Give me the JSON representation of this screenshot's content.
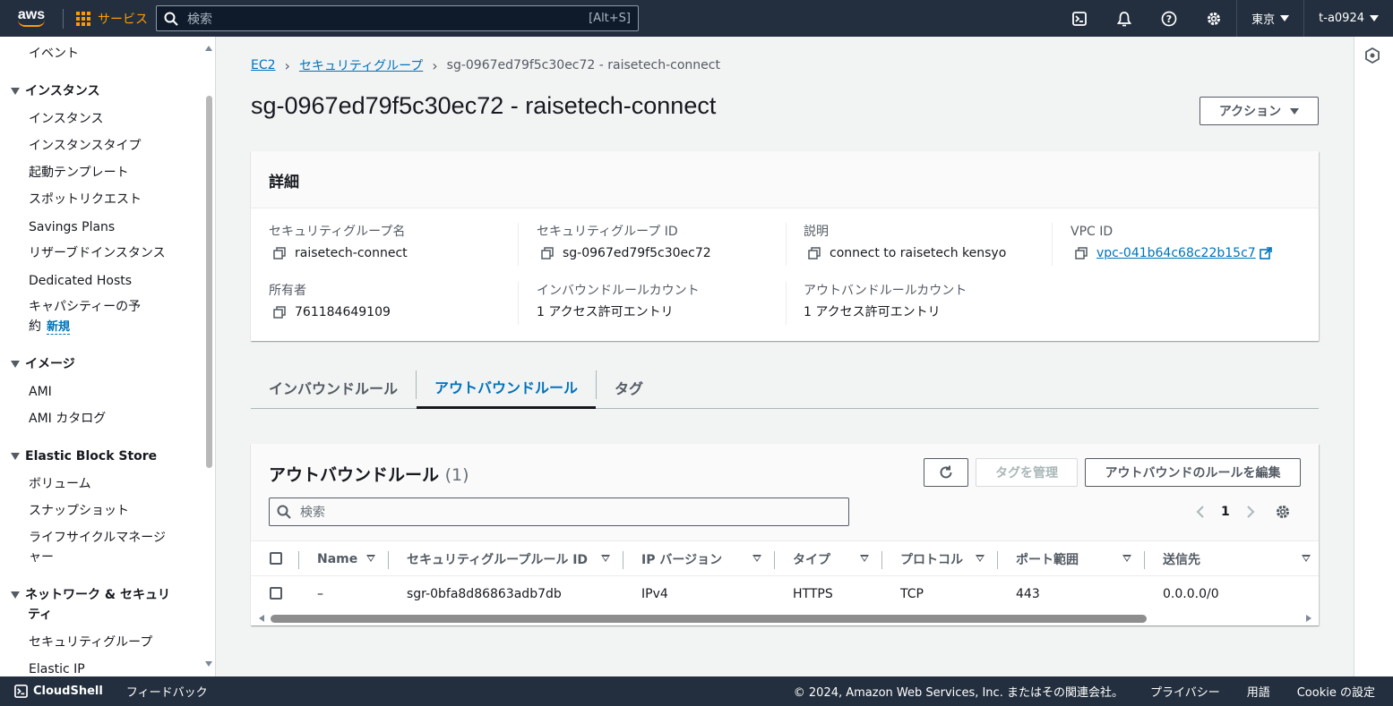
{
  "topnav": {
    "logo": "aws",
    "services_label": "サービス",
    "search_placeholder": "検索",
    "search_shortcut": "[Alt+S]",
    "region": "東京",
    "account": "t-a0924"
  },
  "sidebar": {
    "items": [
      {
        "label": "イベント"
      },
      {
        "label": "インスタンス",
        "header": true
      },
      {
        "label": "インスタンス"
      },
      {
        "label": "インスタンスタイプ"
      },
      {
        "label": "起動テンプレート"
      },
      {
        "label": "スポットリクエスト"
      },
      {
        "label": "Savings Plans"
      },
      {
        "label": "リザーブドインスタンス"
      },
      {
        "label": "Dedicated Hosts"
      },
      {
        "label": "キャパシティーの予"
      },
      {
        "label": "約"
      },
      {
        "label": "イメージ",
        "header": true
      },
      {
        "label": "AMI"
      },
      {
        "label": "AMI カタログ"
      },
      {
        "label": "Elastic Block Store",
        "header": true
      },
      {
        "label": "ボリューム"
      },
      {
        "label": "スナップショット"
      },
      {
        "label": "ライフサイクルマネージ"
      },
      {
        "label": "ャー"
      },
      {
        "label": "ネットワーク & セキュリ",
        "header": true
      },
      {
        "label": "ティ",
        "header": true
      },
      {
        "label": "セキュリティグループ"
      },
      {
        "label": "Elastic IP"
      }
    ],
    "new_badge": "新規"
  },
  "breadcrumb": {
    "items": [
      "EC2",
      "セキュリティグループ"
    ],
    "current": "sg-0967ed79f5c30ec72 - raisetech-connect"
  },
  "page": {
    "title": "sg-0967ed79f5c30ec72 - raisetech-connect",
    "actions_label": "アクション"
  },
  "details": {
    "heading": "詳細",
    "fields": [
      {
        "key": "セキュリティグループ名",
        "value": "raisetech-connect"
      },
      {
        "key": "セキュリティグループ ID",
        "value": "sg-0967ed79f5c30ec72"
      },
      {
        "key": "説明",
        "value": "connect to raisetech kensyo"
      },
      {
        "key": "VPC ID",
        "value": "vpc-041b64c68c22b15c7"
      },
      {
        "key": "所有者",
        "value": "761184649109"
      },
      {
        "key": "インバウンドルールカウント",
        "value": "1 アクセス許可エントリ"
      },
      {
        "key": "アウトバンドルールカウント",
        "value": "1 アクセス許可エントリ"
      }
    ]
  },
  "tabs": [
    {
      "label": "インバウンドルール"
    },
    {
      "label": "アウトバウンドルール",
      "active": true
    },
    {
      "label": "タグ"
    }
  ],
  "rules": {
    "title": "アウトバウンドルール",
    "count": "(1)",
    "manage_tags_label": "タグを管理",
    "edit_label": "アウトバウンドのルールを編集",
    "filter_placeholder": "検索",
    "page": "1",
    "columns": [
      "Name",
      "セキュリティグループルール ID",
      "IP バージョン",
      "タイプ",
      "プロトコル",
      "ポート範囲",
      "送信先"
    ],
    "rows": [
      [
        "–",
        "sgr-0bfa8d86863adb7db",
        "IPv4",
        "HTTPS",
        "TCP",
        "443",
        "0.0.0.0/0"
      ]
    ]
  },
  "footer": {
    "cloudshell": "CloudShell",
    "feedback": "フィードバック",
    "copyright": "© 2024, Amazon Web Services, Inc. またはその関連会社。",
    "privacy": "プライバシー",
    "terms": "用語",
    "cookie": "Cookie の設定"
  },
  "colors": {
    "nav_bg": "#232f3e",
    "accent": "#ff9900",
    "link": "#0073bb"
  }
}
